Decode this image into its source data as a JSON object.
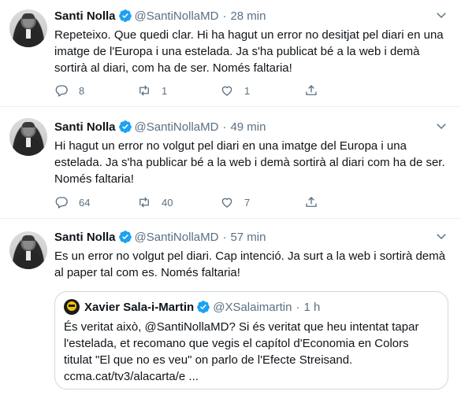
{
  "tweets": [
    {
      "name": "Santi Nolla",
      "handle": "@SantiNollaMD",
      "time": "28 min",
      "text": "Repeteixo. Que quedi clar. Hi ha hagut un error no desitjat pel diari en una imatge de l'Europa i una estelada. Ja s'ha publicat bé a la web i demà sortirà al diari, com ha de ser. Només faltaria!",
      "replies": "8",
      "retweets": "1",
      "likes": "1"
    },
    {
      "name": "Santi Nolla",
      "handle": "@SantiNollaMD",
      "time": "49 min",
      "text": "Hi hagut un error no volgut pel diari en una imatge del Europa i una estelada. Ja s'ha publicar bé a la web i demà sortirà al diari com ha de ser. Només faltaria!",
      "replies": "64",
      "retweets": "40",
      "likes": "7"
    },
    {
      "name": "Santi Nolla",
      "handle": "@SantiNollaMD",
      "time": "57 min",
      "text": "Es un error no volgut pel diari. Cap intenció. Ja surt a la web i sortirà demà al paper tal com es. Només faltaria!"
    }
  ],
  "quoted": {
    "name": "Xavier Sala-i-Martin",
    "handle": "@XSalaimartin",
    "time": "1 h",
    "text": "És veritat això, @SantiNollaMD? Si és veritat que heu intentat tapar l'estelada, et recomano que vegis el capítol d'Economia en Colors titulat \"El que no es veu\" on parlo de l'Efecte Streisand. ccma.cat/tv3/alacarta/e ..."
  },
  "separator": "·",
  "colors": {
    "verified": "#1da1f2",
    "muted": "#5b7083",
    "border": "#ebeef0"
  },
  "icons": [
    "verified-badge-icon",
    "chevron-down-icon",
    "reply-icon",
    "retweet-icon",
    "like-icon",
    "share-icon"
  ]
}
